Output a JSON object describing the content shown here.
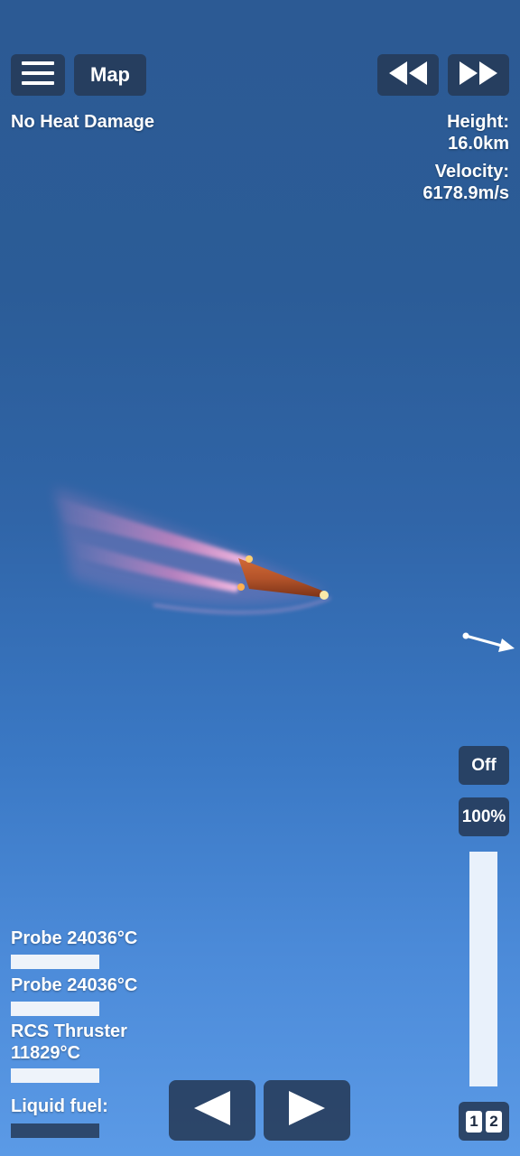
{
  "top_bar": {
    "map_label": "Map",
    "menu_icon": "hamburger-menu-icon",
    "rewind_icon": "rewind-icon",
    "fast_forward_icon": "fast-forward-icon"
  },
  "status": {
    "heat_label": "No Heat Damage"
  },
  "telemetry": {
    "height_label": "Height:",
    "height_value": "16.0km",
    "velocity_label": "Velocity:",
    "velocity_value": "6178.9m/s"
  },
  "parts": [
    {
      "name": "Probe 24036°C",
      "fill": 1.0
    },
    {
      "name": "Probe 24036°C",
      "fill": 1.0
    },
    {
      "name": "RCS Thruster",
      "temperature": "11829°C",
      "fill": 1.0
    }
  ],
  "fuel": {
    "label": "Liquid fuel:",
    "fill": 0.0
  },
  "controls": {
    "rcs_toggle_label": "Off",
    "throttle_label": "100%",
    "throttle_level": 1.0,
    "stage_numbers": [
      "1",
      "2"
    ],
    "rotate_left_icon": "triangle-left-icon",
    "rotate_right_icon": "triangle-right-icon"
  },
  "colors": {
    "button_bg": "#263a58",
    "bar_fill": "#eef3fa",
    "plasma": "#ff8fc8",
    "hull": "#b4542a"
  }
}
